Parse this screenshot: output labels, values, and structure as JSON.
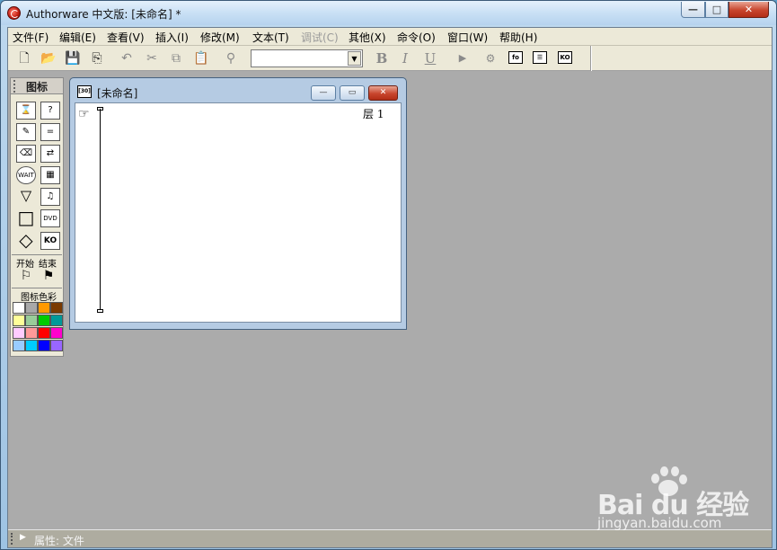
{
  "window": {
    "title": "Authorware 中文版: [未命名] *",
    "min_label": "—",
    "max_label": "□",
    "close_label": "✕"
  },
  "menu": {
    "items": [
      {
        "label": "文件(F)",
        "enabled": true
      },
      {
        "label": "编辑(E)",
        "enabled": true
      },
      {
        "label": "查看(V)",
        "enabled": true
      },
      {
        "label": "插入(I)",
        "enabled": true
      },
      {
        "label": "修改(M)",
        "enabled": true
      },
      {
        "label": "文本(T)",
        "enabled": true
      },
      {
        "label": "调试(C)",
        "enabled": false
      },
      {
        "label": "其他(X)",
        "enabled": true
      },
      {
        "label": "命令(O)",
        "enabled": true
      },
      {
        "label": "窗口(W)",
        "enabled": true
      },
      {
        "label": "帮助(H)",
        "enabled": true
      }
    ]
  },
  "toolbar": {
    "new_icon": "🗋",
    "open_icon": "📂",
    "save_icon": "💾",
    "import_icon": "⎘",
    "undo_icon": "↶",
    "cut_icon": "✂",
    "copy_icon": "⧉",
    "paste_icon": "📋",
    "find_icon": "⚲",
    "font_value": "",
    "font_arrow": "▼",
    "bold_label": "B",
    "italic_label": "I",
    "underline_label": "U",
    "run_icon": "▶",
    "control_panel_icon": "⚙",
    "functions_label": "fo",
    "variables_label": "☰",
    "knowledge_label": "KO"
  },
  "palette": {
    "title": "图标",
    "icons": {
      "display": "⌛",
      "interaction_q": "?",
      "calc": "✎",
      "decision_eq": "=",
      "erase": "⌫",
      "navigate": "⇄",
      "wait": "WAIT",
      "movie": "▦",
      "framework": "▽",
      "sound": "♫",
      "map": "□",
      "dvd": "DVD",
      "knowledge": "◇",
      "ko": "KO"
    },
    "start_label": "开始",
    "end_label": "结束",
    "start_flag": "⚐",
    "end_flag": "⚑",
    "color_label": "图标色彩",
    "swatches": [
      "#ffffff",
      "#a8a8a8",
      "#ff9900",
      "#7a3a00",
      "#ffff99",
      "#99cc99",
      "#00cc00",
      "#009999",
      "#ffccff",
      "#ff9999",
      "#ff0000",
      "#ff00cc",
      "#99ccff",
      "#00ccff",
      "#0000ff",
      "#9966ff"
    ]
  },
  "design_window": {
    "title": "[未命名]",
    "icon_label": "[30]",
    "min_label": "—",
    "max_label": "▭",
    "close_label": "✕",
    "hand_icon": "☞",
    "layer_label": "层 1"
  },
  "properties_bar": {
    "arrow": "▶",
    "label": "属性: 文件"
  },
  "watermark": {
    "logo": "Bai du 经验",
    "url": "jingyan.baidu.com"
  }
}
